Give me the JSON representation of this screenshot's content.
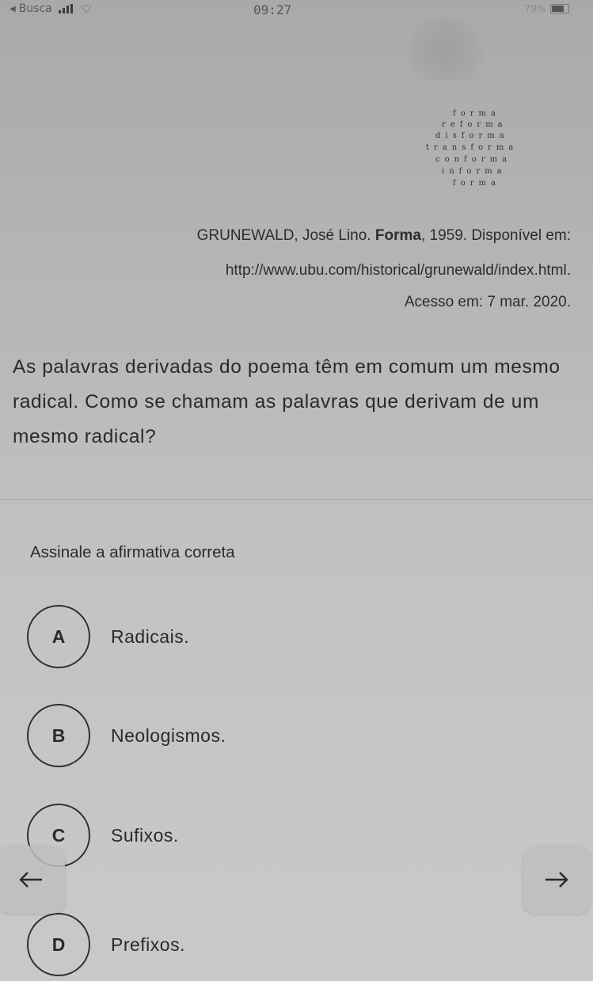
{
  "status_bar": {
    "carrier": "Busca",
    "time": "09:27",
    "battery_percent": "79%"
  },
  "poem": {
    "lines": [
      "forma",
      "reforma",
      "disforma",
      "transforma",
      "conforma",
      "informa",
      "forma"
    ]
  },
  "citation": {
    "author": "GRUNEWALD, José Lino.",
    "title": "Forma",
    "year_note": ", 1959. Disponível em:",
    "url": "http://www.ubu.com/historical/grunewald/index.html.",
    "access": "Acesso em: 7 mar. 2020."
  },
  "question": {
    "text": "As palavras derivadas do poema têm em comum um mesmo radical. Como se chamam as palavras que derivam de um mesmo radical?"
  },
  "instruction": "Assinale a afirmativa correta",
  "options": [
    {
      "letter": "A",
      "text": "Radicais."
    },
    {
      "letter": "B",
      "text": "Neologismos."
    },
    {
      "letter": "C",
      "text": "Sufixos."
    },
    {
      "letter": "D",
      "text": "Prefixos."
    }
  ],
  "navigation": {
    "prev_icon": "arrow-left-icon",
    "next_icon": "arrow-right-icon"
  }
}
